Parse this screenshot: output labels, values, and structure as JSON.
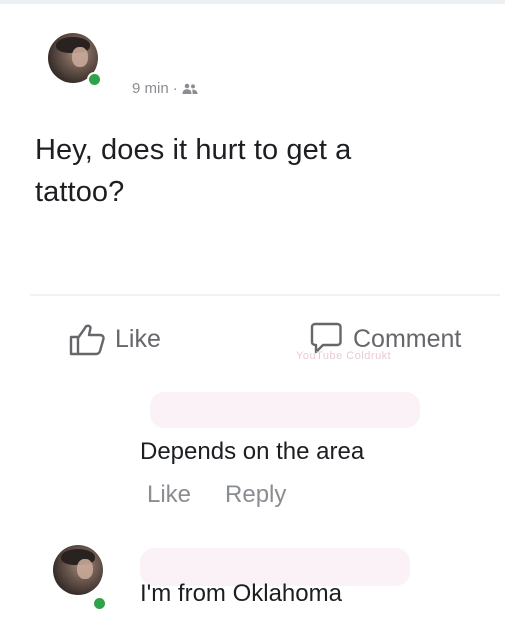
{
  "post": {
    "time": "9 min",
    "separator": "·",
    "audience_icon": "friends-icon",
    "text_line1": "Hey, does it hurt to get a",
    "text_line2": "tattoo?"
  },
  "actions": {
    "like_label": "Like",
    "like_icon": "thumbs-up-icon",
    "comment_label": "Comment",
    "comment_icon": "comment-bubble-icon"
  },
  "watermark": "YouTube Coldrukt",
  "comments": [
    {
      "text": "Depends on the area",
      "like_label": "Like",
      "reply_label": "Reply"
    },
    {
      "text": "I'm from Oklahoma"
    }
  ],
  "colors": {
    "online": "#31a24c",
    "meta": "#8a8d91",
    "action": "#65676b"
  }
}
